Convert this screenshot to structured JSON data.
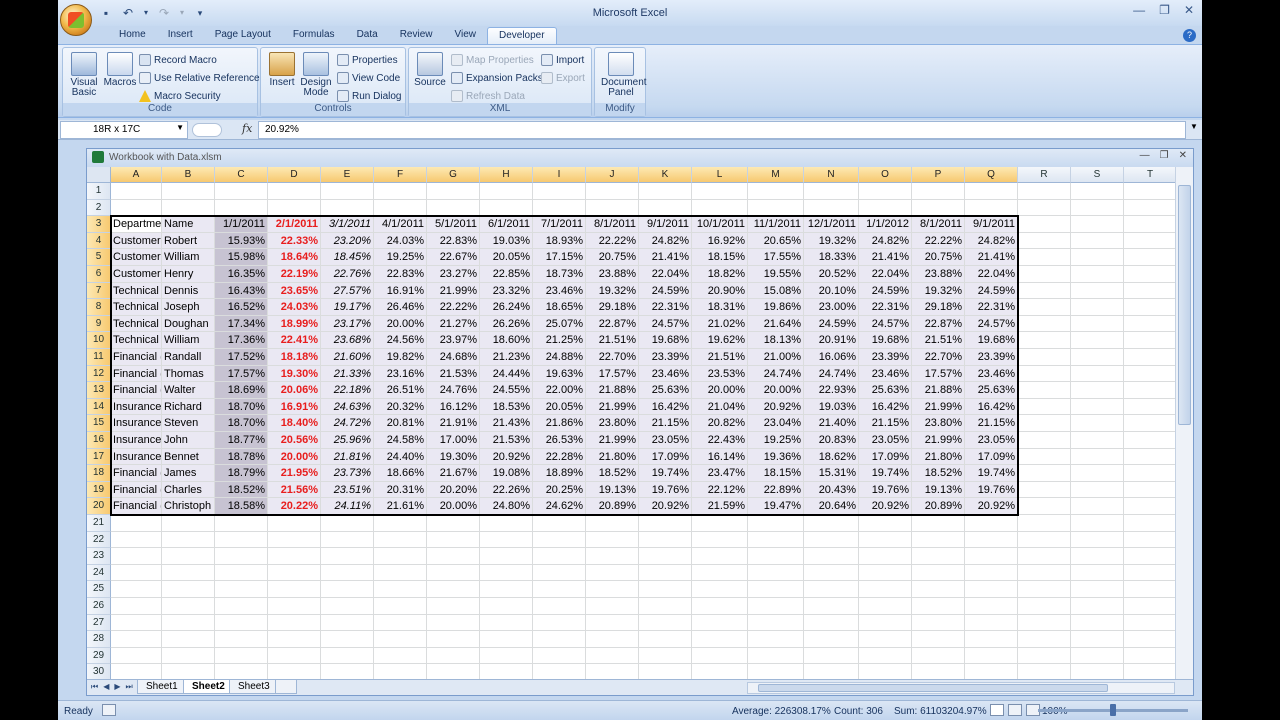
{
  "app": {
    "title": "Microsoft Excel"
  },
  "ribbon_tabs": [
    "Home",
    "Insert",
    "Page Layout",
    "Formulas",
    "Data",
    "Review",
    "View",
    "Developer"
  ],
  "ribbon": {
    "code": {
      "label": "Code",
      "visual_basic": "Visual Basic",
      "macros": "Macros",
      "record_macro": "Record Macro",
      "use_relative": "Use Relative References",
      "macro_security": "Macro Security"
    },
    "controls": {
      "label": "Controls",
      "insert": "Insert",
      "design_mode": "Design Mode",
      "properties": "Properties",
      "view_code": "View Code",
      "run_dialog": "Run Dialog"
    },
    "xml": {
      "label": "XML",
      "source": "Source",
      "map_properties": "Map Properties",
      "expansion_packs": "Expansion Packs",
      "refresh_data": "Refresh Data",
      "import": "Import",
      "export": "Export"
    },
    "modify": {
      "label": "Modify",
      "document_panel": "Document Panel"
    }
  },
  "formula_bar": {
    "name_box": "18R x 17C",
    "formula": "20.92%"
  },
  "workbook": {
    "title": "Workbook with Data.xlsm"
  },
  "columns": [
    "A",
    "B",
    "C",
    "D",
    "E",
    "F",
    "G",
    "H",
    "I",
    "J",
    "K",
    "L",
    "M",
    "N",
    "O",
    "P",
    "Q",
    "R",
    "S",
    "T"
  ],
  "rows": [
    "1",
    "2",
    "3",
    "4",
    "5",
    "6",
    "7",
    "8",
    "9",
    "10",
    "11",
    "12",
    "13",
    "14",
    "15",
    "16",
    "17",
    "18",
    "19",
    "20",
    "21",
    "22",
    "23",
    "24",
    "25",
    "26",
    "27",
    "28",
    "29",
    "30"
  ],
  "table": {
    "headers": [
      "Departme",
      "Name",
      "1/1/2011",
      "2/1/2011",
      "3/1/2011",
      "4/1/2011",
      "5/1/2011",
      "6/1/2011",
      "7/1/2011",
      "8/1/2011",
      "9/1/2011",
      "10/1/2011",
      "11/1/2011",
      "12/1/2011",
      "1/1/2012",
      "8/1/2011",
      "9/1/2011"
    ],
    "rows": [
      [
        "Customer",
        "Robert",
        "15.93%",
        "22.33%",
        "23.20%",
        "24.03%",
        "22.83%",
        "19.03%",
        "18.93%",
        "22.22%",
        "24.82%",
        "16.92%",
        "20.65%",
        "19.32%",
        "24.82%",
        "22.22%",
        "24.82%"
      ],
      [
        "Customer",
        "William",
        "15.98%",
        "18.64%",
        "18.45%",
        "19.25%",
        "22.67%",
        "20.05%",
        "17.15%",
        "20.75%",
        "21.41%",
        "18.15%",
        "17.55%",
        "18.33%",
        "21.41%",
        "20.75%",
        "21.41%"
      ],
      [
        "Customer",
        "Henry",
        "16.35%",
        "22.19%",
        "22.76%",
        "22.83%",
        "23.27%",
        "22.85%",
        "18.73%",
        "23.88%",
        "22.04%",
        "18.82%",
        "19.55%",
        "20.52%",
        "22.04%",
        "23.88%",
        "22.04%"
      ],
      [
        "Technical",
        "Dennis",
        "16.43%",
        "23.65%",
        "27.57%",
        "16.91%",
        "21.99%",
        "23.32%",
        "23.46%",
        "19.32%",
        "24.59%",
        "20.90%",
        "15.08%",
        "20.10%",
        "24.59%",
        "19.32%",
        "24.59%"
      ],
      [
        "Technical",
        "Joseph",
        "16.52%",
        "24.03%",
        "19.17%",
        "26.46%",
        "22.22%",
        "26.24%",
        "18.65%",
        "29.18%",
        "22.31%",
        "18.31%",
        "19.86%",
        "23.00%",
        "22.31%",
        "29.18%",
        "22.31%"
      ],
      [
        "Technical",
        "Doughan",
        "17.34%",
        "18.99%",
        "23.17%",
        "20.00%",
        "21.27%",
        "26.26%",
        "25.07%",
        "22.87%",
        "24.57%",
        "21.02%",
        "21.64%",
        "24.59%",
        "24.57%",
        "22.87%",
        "24.57%"
      ],
      [
        "Technical",
        "William",
        "17.36%",
        "22.41%",
        "23.68%",
        "24.56%",
        "23.97%",
        "18.60%",
        "21.25%",
        "21.51%",
        "19.68%",
        "19.62%",
        "18.13%",
        "20.91%",
        "19.68%",
        "21.51%",
        "19.68%"
      ],
      [
        "Financial (",
        "Randall",
        "17.52%",
        "18.18%",
        "21.60%",
        "19.82%",
        "24.68%",
        "21.23%",
        "24.88%",
        "22.70%",
        "23.39%",
        "21.51%",
        "21.00%",
        "16.06%",
        "23.39%",
        "22.70%",
        "23.39%"
      ],
      [
        "Financial (",
        "Thomas",
        "17.57%",
        "19.30%",
        "21.33%",
        "23.16%",
        "21.53%",
        "24.44%",
        "19.63%",
        "17.57%",
        "23.46%",
        "23.53%",
        "24.74%",
        "24.74%",
        "23.46%",
        "17.57%",
        "23.46%"
      ],
      [
        "Financial (",
        "Walter",
        "18.69%",
        "20.06%",
        "22.18%",
        "26.51%",
        "24.76%",
        "24.55%",
        "22.00%",
        "21.88%",
        "25.63%",
        "20.00%",
        "20.00%",
        "22.93%",
        "25.63%",
        "21.88%",
        "25.63%"
      ],
      [
        "Insurance",
        "Richard",
        "18.70%",
        "16.91%",
        "24.63%",
        "20.32%",
        "16.12%",
        "18.53%",
        "20.05%",
        "21.99%",
        "16.42%",
        "21.04%",
        "20.92%",
        "19.03%",
        "16.42%",
        "21.99%",
        "16.42%"
      ],
      [
        "Insurance",
        "Steven",
        "18.70%",
        "18.40%",
        "24.72%",
        "20.81%",
        "21.91%",
        "21.43%",
        "21.86%",
        "23.80%",
        "21.15%",
        "20.82%",
        "23.04%",
        "21.40%",
        "21.15%",
        "23.80%",
        "21.15%"
      ],
      [
        "Insurance",
        "John",
        "18.77%",
        "20.56%",
        "25.96%",
        "24.58%",
        "17.00%",
        "21.53%",
        "26.53%",
        "21.99%",
        "23.05%",
        "22.43%",
        "19.25%",
        "20.83%",
        "23.05%",
        "21.99%",
        "23.05%"
      ],
      [
        "Insurance",
        "Bennet",
        "18.78%",
        "20.00%",
        "21.81%",
        "24.40%",
        "19.30%",
        "20.92%",
        "22.28%",
        "21.80%",
        "17.09%",
        "16.14%",
        "19.36%",
        "18.62%",
        "17.09%",
        "21.80%",
        "17.09%"
      ],
      [
        "Financial (",
        "James",
        "18.79%",
        "21.95%",
        "23.73%",
        "18.66%",
        "21.67%",
        "19.08%",
        "18.89%",
        "18.52%",
        "19.74%",
        "23.47%",
        "18.15%",
        "15.31%",
        "19.74%",
        "18.52%",
        "19.74%"
      ],
      [
        "Financial (",
        "Charles",
        "18.52%",
        "21.56%",
        "23.51%",
        "20.31%",
        "20.20%",
        "22.26%",
        "20.25%",
        "19.13%",
        "19.76%",
        "22.12%",
        "22.89%",
        "20.43%",
        "19.76%",
        "19.13%",
        "19.76%"
      ],
      [
        "Financial (",
        "Christoph",
        "18.58%",
        "20.22%",
        "24.11%",
        "21.61%",
        "20.00%",
        "24.80%",
        "24.62%",
        "20.89%",
        "20.92%",
        "21.59%",
        "19.47%",
        "20.64%",
        "20.92%",
        "20.89%",
        "20.92%"
      ]
    ]
  },
  "sheets": [
    "Sheet1",
    "Sheet2",
    "Sheet3"
  ],
  "active_sheet": "Sheet2",
  "status": {
    "mode": "Ready",
    "average": "Average: 226308.17%",
    "count": "Count: 306",
    "sum": "Sum: 61103204.97%",
    "zoom": "100%"
  }
}
